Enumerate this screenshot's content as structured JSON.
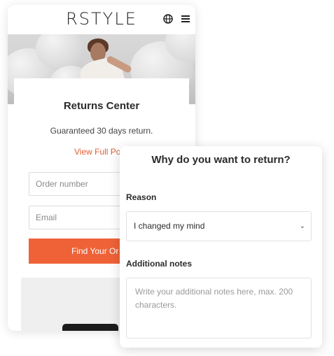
{
  "header": {
    "brand": "RSTYLE",
    "globe_icon": "globe-icon",
    "menu_icon": "hamburger-menu-icon"
  },
  "returns": {
    "title": "Returns Center",
    "subtitle": "Guaranteed 30 days return.",
    "policy_link": "View Full Poli",
    "order_placeholder": "Order number",
    "email_placeholder": "Email",
    "find_button": "Find Your Or"
  },
  "modal": {
    "title": "Why do you want to return?",
    "reason_label": "Reason",
    "reason_value": "I changed my mind",
    "notes_label": "Additional notes",
    "notes_placeholder": "Write your additional notes here, max. 200 characters."
  },
  "colors": {
    "accent": "#ef6237",
    "link": "#e35d32"
  }
}
